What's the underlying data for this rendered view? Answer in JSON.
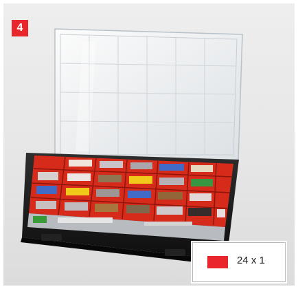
{
  "badge": {
    "number": "4"
  },
  "legend": {
    "label": "24 x 1",
    "color": "#e8262b"
  },
  "colors": {
    "accent": "#e8262b",
    "case_body": "#1c1c1c",
    "tray": "#e0301f",
    "lid": "#ecf0f3"
  },
  "image": {
    "subject": "organizer-case",
    "parts": [
      "lid-icon",
      "tray-grid",
      "hardware-items"
    ]
  }
}
